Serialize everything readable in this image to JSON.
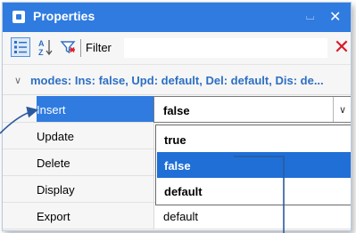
{
  "window": {
    "title": "Properties",
    "pin_glyph": "⌴",
    "close_glyph": "✕",
    "title_icon": "properties-icon"
  },
  "toolbar": {
    "categorized_icon": "categorized-view-icon",
    "alphabetical_icon": "sort-az-icon",
    "filter_icon": "filter-icon",
    "filter_label": "Filter",
    "filter_value": "",
    "clear_glyph": "✕"
  },
  "category": {
    "chevron": "∨",
    "text": "modes: Ins: false, Upd: default, Del: default, Dis: de..."
  },
  "properties": [
    {
      "name": "Insert",
      "value": "false",
      "selected": true
    },
    {
      "name": "Update",
      "value": ""
    },
    {
      "name": "Delete",
      "value": ""
    },
    {
      "name": "Display",
      "value": ""
    },
    {
      "name": "Export",
      "value": "default"
    }
  ],
  "dropdown": {
    "arrow_glyph": "∨",
    "options": [
      "true",
      "false",
      "default"
    ],
    "highlighted": "false"
  },
  "colors": {
    "accent": "#2f7be0",
    "category_text": "#2d6fc4",
    "clear_red": "#d81b2a",
    "callout_blue": "#2c5aa0"
  }
}
